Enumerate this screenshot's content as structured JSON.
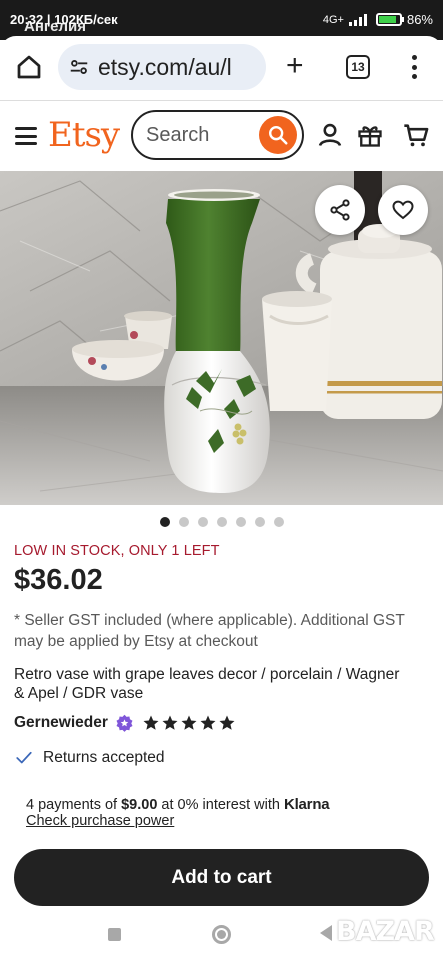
{
  "status_bar": {
    "time": "20:32",
    "speed": "102КБ/сек",
    "carrier_overlay": "Ангелия",
    "signal_label": "4G+",
    "battery": "86%",
    "battery_level": 0.86
  },
  "browser": {
    "url": "etsy.com/au/l",
    "tab_count": "13"
  },
  "header": {
    "logo": "Etsy",
    "search_placeholder": "Search"
  },
  "gallery": {
    "image_count": 7,
    "active_index": 0
  },
  "listing": {
    "stock_notice": "LOW IN STOCK, ONLY 1 LEFT",
    "price": "$36.02",
    "gst_note": "* Seller GST included (where applicable). Additional GST may be applied by Etsy at checkout",
    "title": "Retro vase with grape leaves decor / porcelain / Wagner & Apel / GDR vase",
    "seller": "Gernewieder",
    "rating": 5,
    "returns": "Returns accepted"
  },
  "payments": {
    "prefix": "4 payments of ",
    "amount": "$9.00",
    "suffix": " at 0% interest with ",
    "provider": "Klarna",
    "link": "Check purchase power"
  },
  "cta": {
    "add_to_cart": "Add to cart"
  },
  "watermark": "BAZAR",
  "colors": {
    "etsy_orange": "#f1641e",
    "stock_red": "#a61a2e",
    "button_dark": "#222222",
    "vase_green": "#3f6b22"
  }
}
